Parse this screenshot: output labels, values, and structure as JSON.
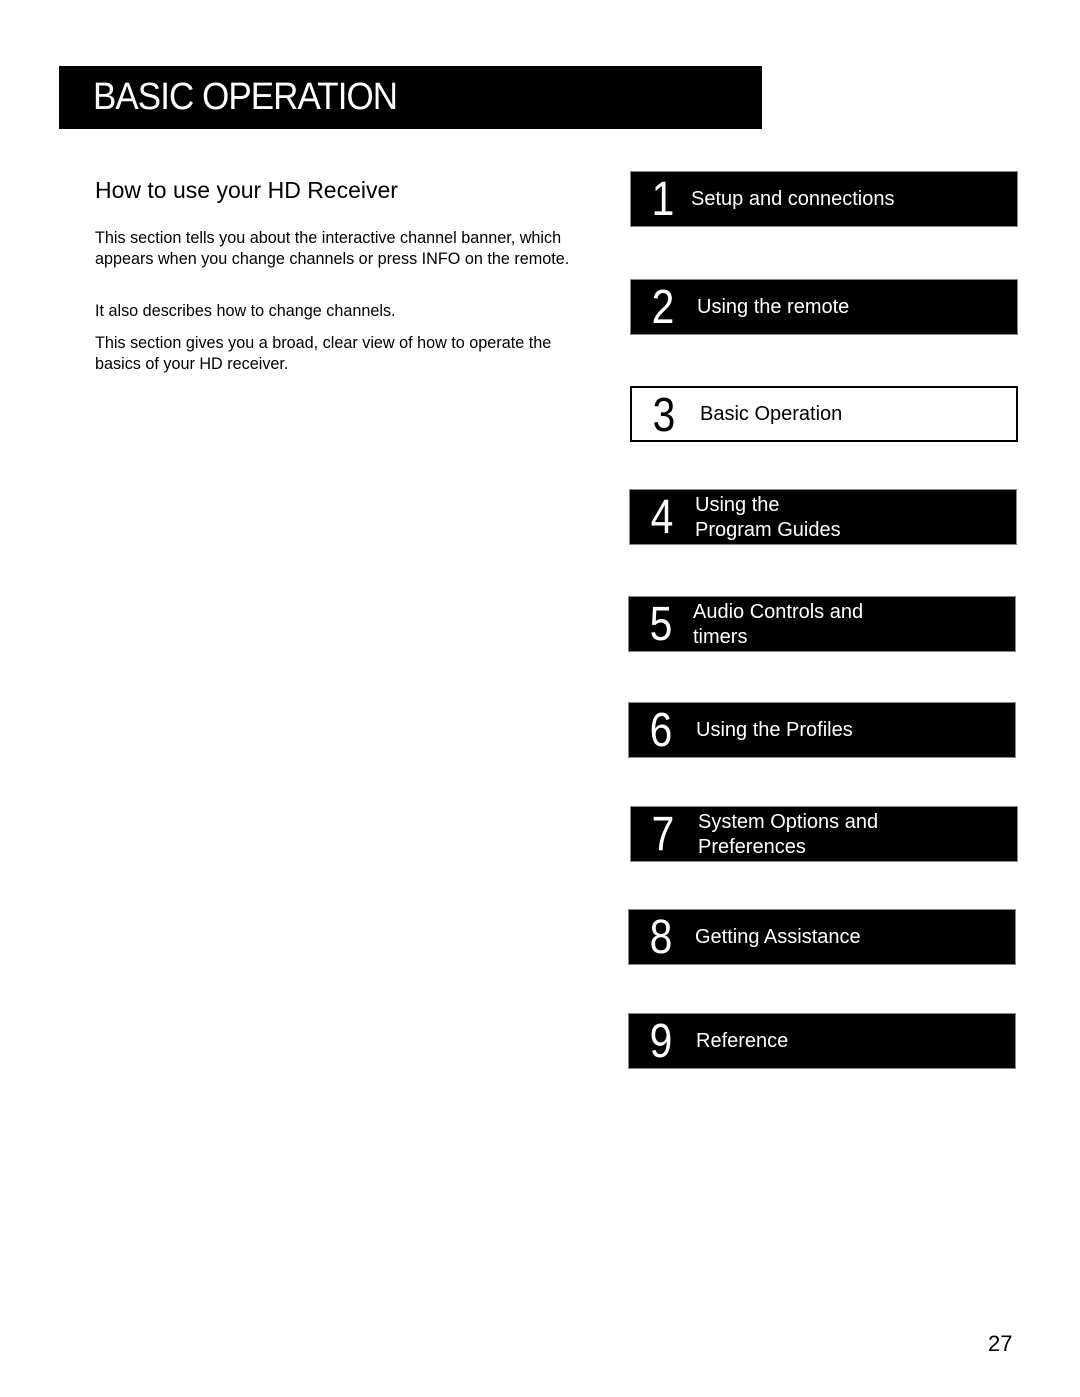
{
  "banner": {
    "title": "BASIC OPERATION"
  },
  "section": {
    "heading": "How to use your HD Receiver",
    "paragraphs": [
      "This section tells you about the interactive channel banner, which appears when you change channels or press INFO on the remote.",
      "It also describes how to change channels.",
      "This section gives you a broad, clear view of how to operate the basics of your HD receiver."
    ]
  },
  "chapters": [
    {
      "number": "1",
      "label": "Setup and connections",
      "current": false
    },
    {
      "number": "2",
      "label": "Using the remote",
      "current": false
    },
    {
      "number": "3",
      "label": "Basic Operation",
      "current": true
    },
    {
      "number": "4",
      "label": "Using the\nProgram Guides",
      "current": false
    },
    {
      "number": "5",
      "label": "Audio Controls and\ntimers",
      "current": false
    },
    {
      "number": "6",
      "label": "Using the Profiles",
      "current": false
    },
    {
      "number": "7",
      "label": "System Options and\nPreferences",
      "current": false
    },
    {
      "number": "8",
      "label": "Getting Assistance",
      "current": false
    },
    {
      "number": "9",
      "label": "Reference",
      "current": false
    }
  ],
  "page": {
    "number": "27"
  }
}
